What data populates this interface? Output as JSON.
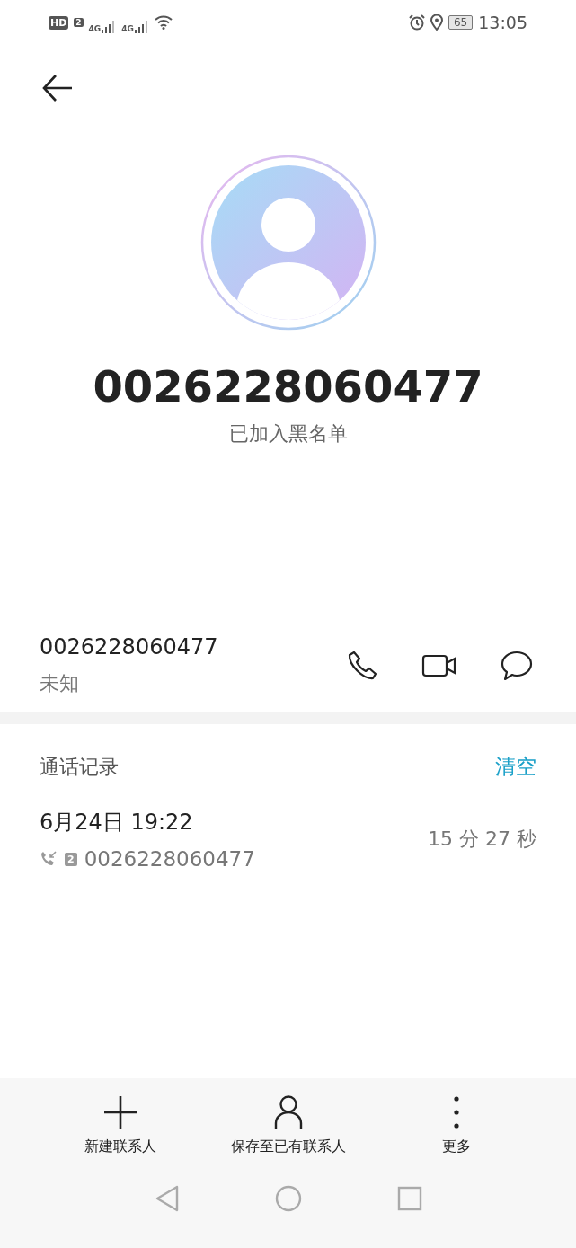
{
  "status_bar": {
    "hd": "HD",
    "hd_sim": "2",
    "networks": [
      "4G",
      "4G"
    ],
    "battery": "65",
    "time": "13:05"
  },
  "header": {
    "number": "0026228060477",
    "subtitle": "已加入黑名单"
  },
  "number_row": {
    "number": "0026228060477",
    "location": "未知"
  },
  "call_log": {
    "title": "通话记录",
    "clear": "清空",
    "entries": [
      {
        "datetime": "6月24日 19:22",
        "sim": "2",
        "number": "0026228060477",
        "duration": "15 分 27 秒"
      }
    ]
  },
  "actions": [
    {
      "label": "新建联系人",
      "kind": "add"
    },
    {
      "label": "保存至已有联系人",
      "kind": "person"
    },
    {
      "label": "更多",
      "kind": "more"
    }
  ]
}
